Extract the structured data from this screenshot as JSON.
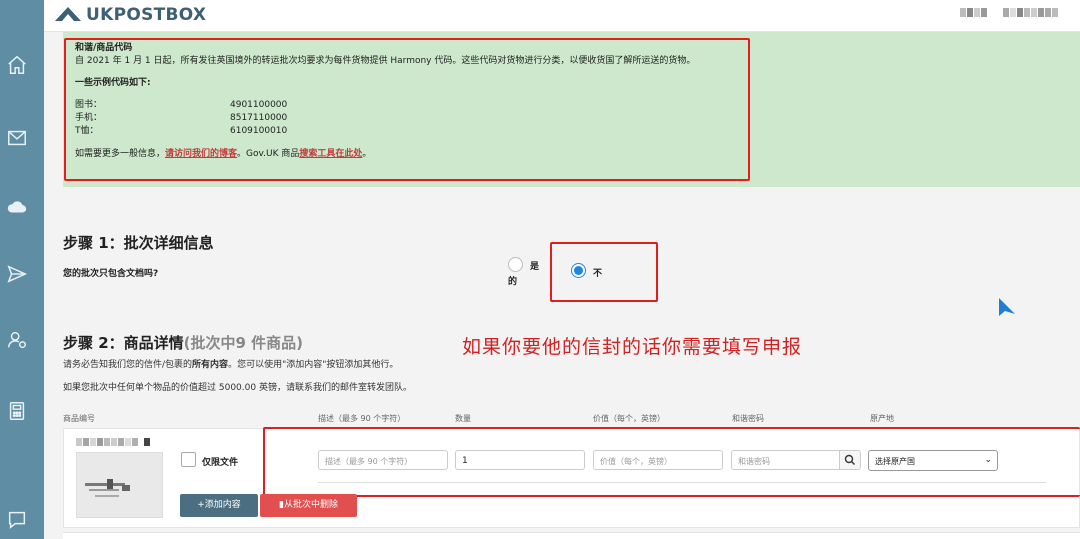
{
  "header": {
    "logo_text": "UKPOSTBOX"
  },
  "sidebar": {
    "items": [
      "home-icon",
      "mail-icon",
      "cloud-icon",
      "send-icon",
      "user-settings-icon",
      "calculator-icon",
      "chat-icon"
    ]
  },
  "notice": {
    "title": "和谐/商品代码",
    "line1": "自 2021 年 1 月 1 日起，所有发往英国境外的转运批次均要求为每件货物提供 Harmony 代码。这些代码对货物进行分类，以便收货国了解所运送的货物。",
    "examples_title": "一些示例代码如下:",
    "codes": [
      {
        "label": "图书：",
        "code": "4901100000"
      },
      {
        "label": "手机：",
        "code": "8517110000"
      },
      {
        "label": "T恤：",
        "code": "6109100010"
      }
    ],
    "more_prefix": "如需要更多一般信息，",
    "link1": "请访问我们的博客",
    "more_mid": "。Gov.UK 商品",
    "link2": "搜索工具在此处",
    "more_suffix": "。"
  },
  "step1": {
    "title": "步骤 1：批次详细信息",
    "question": "您的批次只包含文档吗?",
    "yes_label_a": "是",
    "yes_label_b": "的",
    "no_label": "不",
    "selected": "no"
  },
  "annotation": "如果你要他的信封的话你需要填写申报",
  "step2": {
    "title": "步骤 2：商品详情",
    "subtitle": "(批次中9 件商品)",
    "note1_pre": "请务必告知我们您的信件/包裹的",
    "note1_bold": "所有内容",
    "note1_post": "。您可以使用\"添加内容\"按钮添加其他行。",
    "note2": "如果您批次中任何单个物品的价值超过 5000.00 英镑，请联系我们的邮件室转发团队。",
    "columns": [
      "商品编号",
      "描述（最多 90 个字符）",
      "数量",
      "价值（每个，英镑）",
      "和谐密码",
      "原产地"
    ],
    "row": {
      "docs_only_label": "仅限文件",
      "description_placeholder": "描述（最多 90 个字符）",
      "quantity": "1",
      "value_placeholder": "价值（每个，英镑）",
      "harmony_placeholder": "和谐密码",
      "origin_selected": "选择原产国"
    },
    "add_button": "+添加内容",
    "remove_button": "从批次中删除"
  },
  "colors": {
    "sidebar": "#5f8ea4",
    "notice_bg": "#cde8cc",
    "annotation_red": "#d42020",
    "radio_blue": "#1f85e0",
    "add_btn": "#4b6f80",
    "del_btn": "#e24f4f"
  }
}
